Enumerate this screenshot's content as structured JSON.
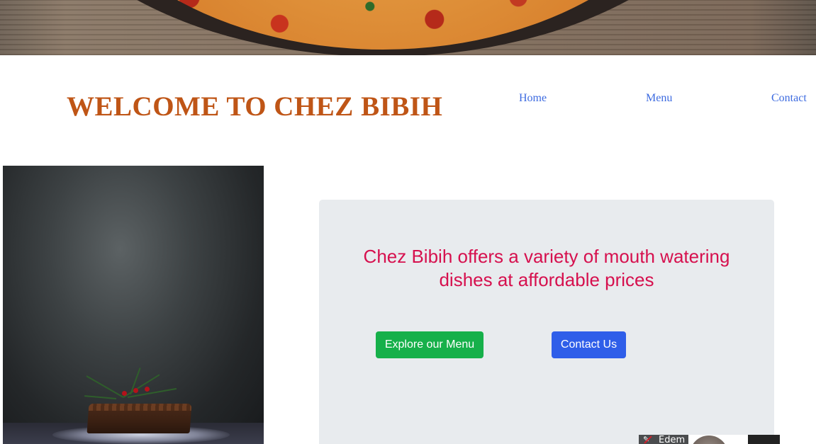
{
  "site": {
    "title": "WELCOME TO CHEZ BIBIH",
    "brand_color": "#bf5516"
  },
  "nav": {
    "items": [
      {
        "label": "Home"
      },
      {
        "label": "Menu"
      },
      {
        "label": "Contact"
      }
    ],
    "link_color": "#3d6be0"
  },
  "hero": {
    "image": "pizza-banner"
  },
  "feature_image": {
    "image": "christmas-cake-photo"
  },
  "card": {
    "tagline": "Chez Bibih offers a variety of mouth watering dishes at affordable prices",
    "tagline_color": "#d6104e",
    "background": "#e8ebee",
    "buttons": {
      "explore_label": "Explore our Menu",
      "contact_label": "Contact Us",
      "explore_color": "#16b04a",
      "contact_color": "#2f5ee9"
    }
  },
  "widget": {
    "name": "Edem",
    "icon": "pencil-icon"
  }
}
